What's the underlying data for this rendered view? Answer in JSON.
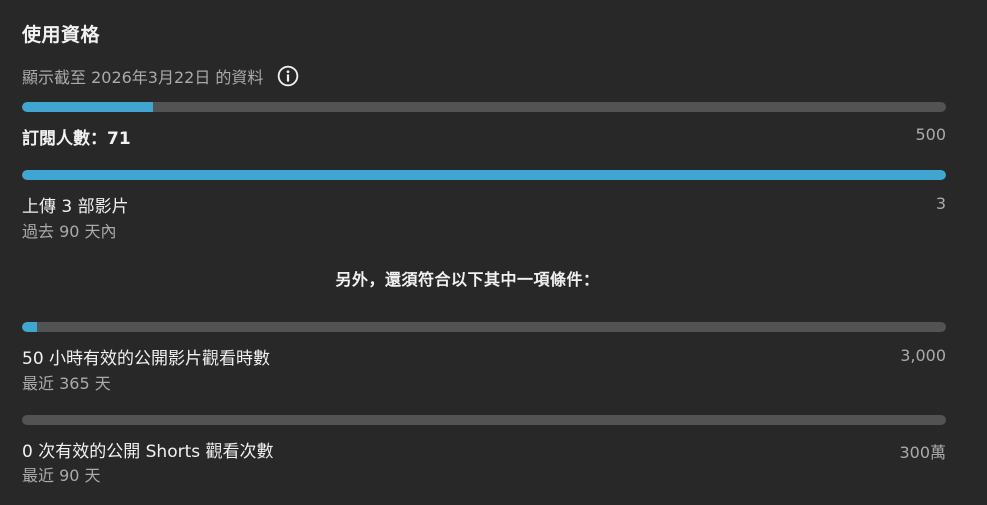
{
  "title": "使用資格",
  "date_note": "顯示截至 2026年3月22日 的資料",
  "accent_color": "#3ea6d0",
  "track_color": "#535353",
  "icons": {
    "info": "info-circle-icon"
  },
  "requirements": [
    {
      "label": "訂閱人數：71",
      "subtitle": "",
      "target": "500",
      "progress": 0.142
    },
    {
      "label": "上傳 3 部影片",
      "subtitle": "過去 90 天內",
      "target": "3",
      "progress": 1.0
    }
  ],
  "additional_heading": "另外，還須符合以下其中一項條件：",
  "options": [
    {
      "label": "50 小時有效的公開影片觀看時數",
      "subtitle": "最近 365 天",
      "target": "3,000",
      "progress": 0.0167
    },
    {
      "label": "0 次有效的公開 Shorts 觀看次數",
      "subtitle": "最近 90 天",
      "target": "300萬",
      "progress": 0.0
    }
  ]
}
